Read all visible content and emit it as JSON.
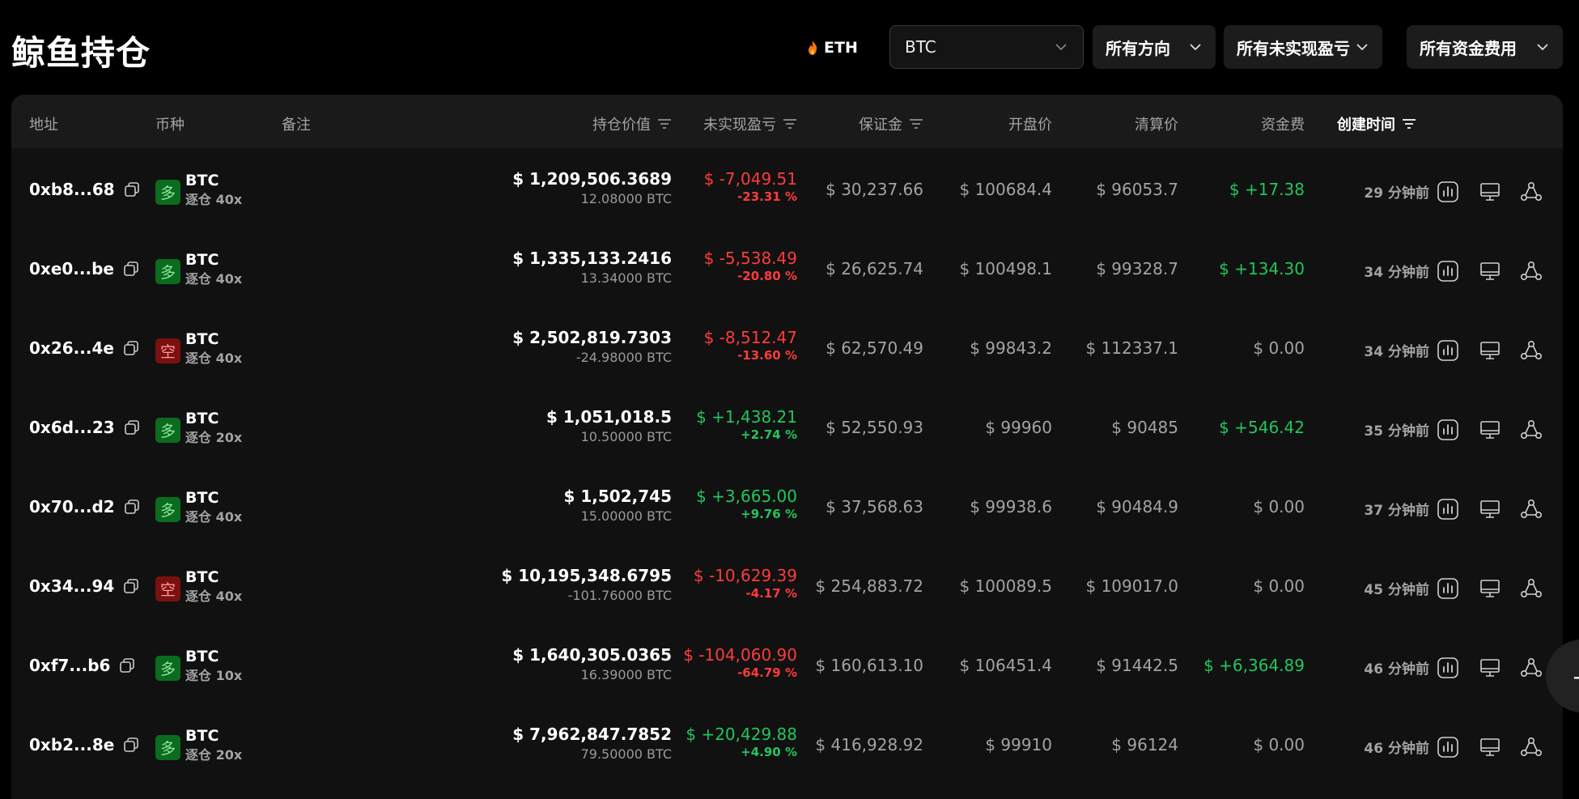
{
  "header": {
    "title": "鲸鱼持仓",
    "eth_label": "ETH",
    "symbol_select": "BTC",
    "direction_filter": "所有方向",
    "pnl_filter": "所有未实现盈亏",
    "fee_filter": "所有资金费用"
  },
  "columns": {
    "address": "地址",
    "coin": "币种",
    "note": "备注",
    "value": "持仓价值",
    "pnl": "未实现盈亏",
    "margin": "保证金",
    "entry": "开盘价",
    "liq": "清算价",
    "fee": "资金费",
    "time": "创建时间"
  },
  "colors": {
    "long": "#0b6b1e",
    "short": "#7a1010",
    "profit": "#22c55e",
    "loss": "#ff3b3b"
  },
  "rows": [
    {
      "addr": "0xb8...68",
      "side": "多",
      "dir": "long",
      "coin": "BTC",
      "lev": "逐仓 40x",
      "value": "$ 1,209,506.3689",
      "qty": "12.08000 BTC",
      "pnl": "$ -7,049.51",
      "pnl_pct": "-23.31 %",
      "pnl_sign": "loss",
      "margin": "$ 30,237.66",
      "entry": "$ 100684.4",
      "liq": "$ 96053.7",
      "fee": "$ +17.38",
      "fee_sign": "profit",
      "time": "29 分钟前"
    },
    {
      "addr": "0xe0...be",
      "side": "多",
      "dir": "long",
      "coin": "BTC",
      "lev": "逐仓 40x",
      "value": "$ 1,335,133.2416",
      "qty": "13.34000 BTC",
      "pnl": "$ -5,538.49",
      "pnl_pct": "-20.80 %",
      "pnl_sign": "loss",
      "margin": "$ 26,625.74",
      "entry": "$ 100498.1",
      "liq": "$ 99328.7",
      "fee": "$ +134.30",
      "fee_sign": "profit",
      "time": "34 分钟前"
    },
    {
      "addr": "0x26...4e",
      "side": "空",
      "dir": "short",
      "coin": "BTC",
      "lev": "逐仓 40x",
      "value": "$ 2,502,819.7303",
      "qty": "-24.98000 BTC",
      "pnl": "$ -8,512.47",
      "pnl_pct": "-13.60 %",
      "pnl_sign": "loss",
      "margin": "$ 62,570.49",
      "entry": "$ 99843.2",
      "liq": "$ 112337.1",
      "fee": "$ 0.00",
      "fee_sign": "zero",
      "time": "34 分钟前"
    },
    {
      "addr": "0x6d...23",
      "side": "多",
      "dir": "long",
      "coin": "BTC",
      "lev": "逐仓 20x",
      "value": "$ 1,051,018.5",
      "qty": "10.50000 BTC",
      "pnl": "$ +1,438.21",
      "pnl_pct": "+2.74 %",
      "pnl_sign": "profit",
      "margin": "$ 52,550.93",
      "entry": "$ 99960",
      "liq": "$ 90485",
      "fee": "$ +546.42",
      "fee_sign": "profit",
      "time": "35 分钟前"
    },
    {
      "addr": "0x70...d2",
      "side": "多",
      "dir": "long",
      "coin": "BTC",
      "lev": "逐仓 40x",
      "value": "$ 1,502,745",
      "qty": "15.00000 BTC",
      "pnl": "$ +3,665.00",
      "pnl_pct": "+9.76 %",
      "pnl_sign": "profit",
      "margin": "$ 37,568.63",
      "entry": "$ 99938.6",
      "liq": "$ 90484.9",
      "fee": "$ 0.00",
      "fee_sign": "zero",
      "time": "37 分钟前"
    },
    {
      "addr": "0x34...94",
      "side": "空",
      "dir": "short",
      "coin": "BTC",
      "lev": "逐仓 40x",
      "value": "$ 10,195,348.6795",
      "qty": "-101.76000 BTC",
      "pnl": "$ -10,629.39",
      "pnl_pct": "-4.17 %",
      "pnl_sign": "loss",
      "margin": "$ 254,883.72",
      "entry": "$ 100089.5",
      "liq": "$ 109017.0",
      "fee": "$ 0.00",
      "fee_sign": "zero",
      "time": "45 分钟前"
    },
    {
      "addr": "0xf7...b6",
      "side": "多",
      "dir": "long",
      "coin": "BTC",
      "lev": "逐仓 10x",
      "value": "$ 1,640,305.0365",
      "qty": "16.39000 BTC",
      "pnl": "$ -104,060.90",
      "pnl_pct": "-64.79 %",
      "pnl_sign": "loss",
      "margin": "$ 160,613.10",
      "entry": "$ 106451.4",
      "liq": "$ 91442.5",
      "fee": "$ +6,364.89",
      "fee_sign": "profit",
      "time": "46 分钟前"
    },
    {
      "addr": "0xb2...8e",
      "side": "多",
      "dir": "long",
      "coin": "BTC",
      "lev": "逐仓 20x",
      "value": "$ 7,962,847.7852",
      "qty": "79.50000 BTC",
      "pnl": "$ +20,429.88",
      "pnl_pct": "+4.90 %",
      "pnl_sign": "profit",
      "margin": "$ 416,928.92",
      "entry": "$ 99910",
      "liq": "$ 96124",
      "fee": "$ 0.00",
      "fee_sign": "zero",
      "time": "46 分钟前"
    }
  ]
}
